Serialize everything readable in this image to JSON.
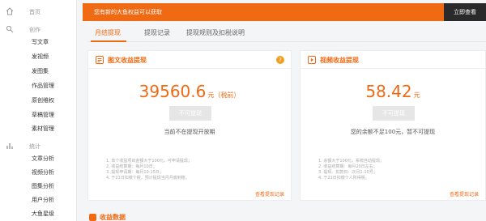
{
  "sidebar": {
    "home_label": "首页",
    "create_label": "创作",
    "create_items": [
      "写文章",
      "发视频",
      "发图集",
      "作品管理",
      "原创维权",
      "草稿管理",
      "素材管理"
    ],
    "stats_label": "统计",
    "stats_items": [
      "文章分析",
      "视频分析",
      "图集分析",
      "用户分析",
      "大鱼星级"
    ]
  },
  "banner": {
    "text": "您有新的大鱼权益可以获取",
    "button_label": "立即查看"
  },
  "tabs": [
    "月结提现",
    "提现记录",
    "提现规则及扣税说明"
  ],
  "cards": {
    "article": {
      "title": "图文收益提现",
      "amount": "39560.6",
      "unit": "元（税前）",
      "button_label": "不可提现",
      "status": "当前不在提现开放期",
      "rules": [
        "1. 单个收益项目金额大于100元，可申请提现；",
        "2. 收益结算期：每月10日；",
        "3. 提现申请期：每月10-15日；",
        "4. 于21日扣缴个税，预计提现当月月底到账。"
      ],
      "link": "查看提现记录"
    },
    "video": {
      "title": "视频收益提现",
      "amount": "58.42",
      "unit": "元",
      "button_label": "不可提现",
      "status": "您的余额不足100元，暂不可提现",
      "rules": [
        "1. 余额大于100元，系统自动提现；",
        "2. 收益结算期：每月20日左右；",
        "3. 提现、扣款日：次月1-10号；",
        "4. 于21日扣缴个人所得税。"
      ],
      "link": "查看提现记录"
    }
  },
  "next_section": {
    "title": "收益数据"
  },
  "colors": {
    "accent": "#f06a14",
    "banner_button": "#2a2a2a"
  }
}
